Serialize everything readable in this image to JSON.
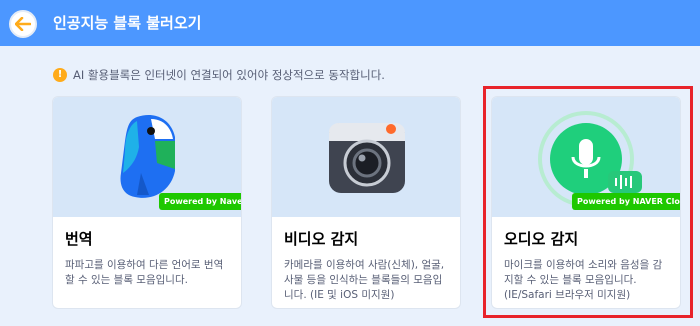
{
  "header": {
    "title": "인공지능 블록 불러오기",
    "back_icon": "arrow-left-icon",
    "background": "#4c97ff"
  },
  "notice": {
    "icon": "info-icon",
    "icon_glyph": "!",
    "text": "AI 활용블록은 인터넷이 연결되어 있어야 정상적으로 동작합니다."
  },
  "cards": [
    {
      "title": "번역",
      "description": "파파고를 이용하여 다른 언어로 번역할 수 있는 블록 모음입니다.",
      "badge": "Powered by Naver",
      "icon": "papago-parrot-icon"
    },
    {
      "title": "비디오 감지",
      "description": "카메라를 이용하여 사람(신체), 얼굴, 사물 등을 인식하는 블록들의 모음입니다. (IE 및 iOS 미지원)",
      "icon": "camera-icon"
    },
    {
      "title": "오디오 감지",
      "description": "마이크를 이용하여 소리와 음성을 감지할 수 있는 블록 모음입니다. (IE/Safari 브라우저 미지원)",
      "badge": "Powered by NAVER Clova",
      "icon": "microphone-icon",
      "selected": true
    }
  ],
  "colors": {
    "accent": "#4c97ff",
    "selection": "#e8232a",
    "naver_green": "#1ec800"
  }
}
